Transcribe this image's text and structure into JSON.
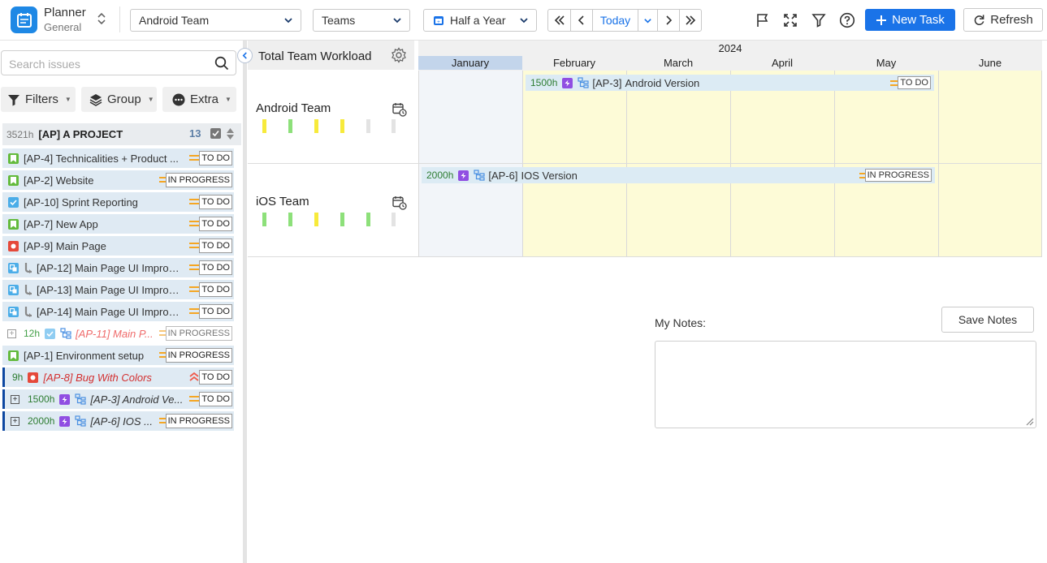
{
  "app": {
    "title": "Planner",
    "subtitle": "General"
  },
  "header": {
    "team_select": "Android Team",
    "teams_select": "Teams",
    "range_select": "Half a Year",
    "today_label": "Today",
    "new_task_label": "New Task",
    "refresh_label": "Refresh"
  },
  "sidebar": {
    "search_placeholder": "Search issues",
    "filters_label": "Filters",
    "group_label": "Group",
    "extra_label": "Extra",
    "project": {
      "hours": "3521h",
      "name": "[AP] A PROJECT",
      "count": "13"
    },
    "issues": [
      {
        "title": "[AP-4] Technicalities + Product ...",
        "status": "TO DO",
        "type": "story"
      },
      {
        "title": "[AP-2] Website",
        "status": "IN PROGRESS",
        "type": "story"
      },
      {
        "title": "[AP-10] Sprint Reporting",
        "status": "TO DO",
        "type": "task"
      },
      {
        "title": "[AP-7] New App",
        "status": "TO DO",
        "type": "story"
      },
      {
        "title": "[AP-9] Main Page",
        "status": "TO DO",
        "type": "bug"
      },
      {
        "title": "[AP-12] Main Page UI Improv...",
        "status": "TO DO",
        "type": "subtask"
      },
      {
        "title": "[AP-13] Main Page UI Improv...",
        "status": "TO DO",
        "type": "subtask"
      },
      {
        "title": "[AP-14] Main Page UI Improv...",
        "status": "TO DO",
        "type": "subtask"
      },
      {
        "hours": "12h",
        "title": "[AP-11] Main P...",
        "status": "IN PROGRESS",
        "type": "task"
      },
      {
        "title": "[AP-1] Environment setup",
        "status": "IN PROGRESS",
        "type": "story"
      },
      {
        "hours": "9h",
        "title": "[AP-8] Bug With Colors",
        "status": "TO DO",
        "type": "bug",
        "priority": "high"
      },
      {
        "hours": "1500h",
        "title": "[AP-3] Android Ve...",
        "status": "TO DO",
        "type": "epic"
      },
      {
        "hours": "2000h",
        "title": "[AP-6] IOS ...",
        "status": "IN PROGRESS",
        "type": "epic"
      }
    ]
  },
  "gantt": {
    "workload_label": "Total Team Workload",
    "year": "2024",
    "months": [
      "January",
      "February",
      "March",
      "April",
      "May",
      "June"
    ],
    "teams": [
      {
        "name": "Android Team",
        "task": {
          "hours": "1500h",
          "key": "[AP-3]",
          "title": "Android Version",
          "status": "TO DO"
        },
        "workload_colors": [
          "#f7ea3b",
          "#8de07a",
          "#f7ea3b",
          "#f7ea3b",
          "#e3e3e3",
          "#e3e3e3"
        ]
      },
      {
        "name": "iOS Team",
        "task": {
          "hours": "2000h",
          "key": "[AP-6]",
          "title": "IOS Version",
          "status": "IN PROGRESS"
        },
        "workload_colors": [
          "#8de07a",
          "#8de07a",
          "#f7ea3b",
          "#8de07a",
          "#8de07a",
          "#e3e3e3"
        ]
      }
    ]
  },
  "notes": {
    "label": "My Notes:",
    "save_label": "Save Notes"
  },
  "colors": {
    "accent": "#1a73e8",
    "story": "#63ba3c",
    "task": "#4bade8",
    "bug": "#e5493a",
    "epic": "#904ee2",
    "priority": "#f5a623"
  }
}
